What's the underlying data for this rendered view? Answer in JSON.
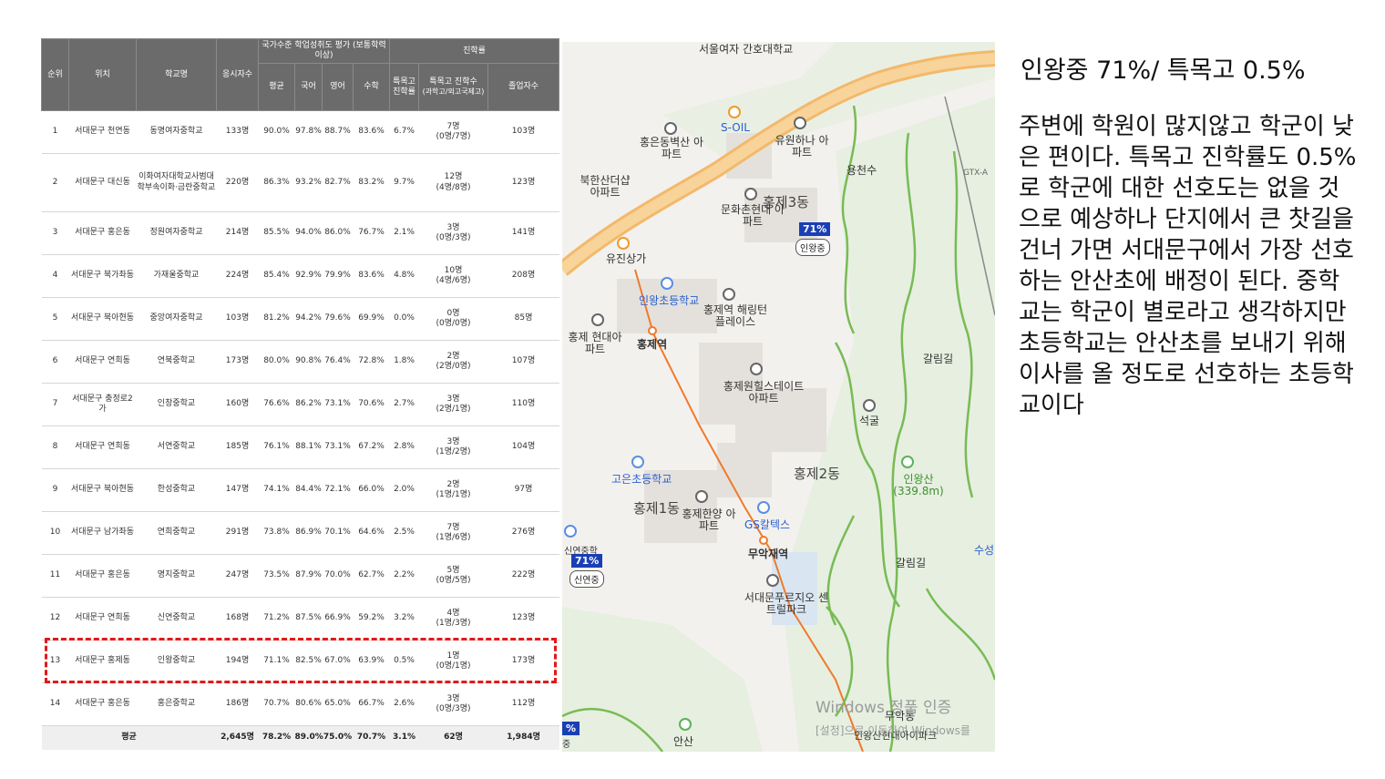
{
  "table": {
    "headers": {
      "rank": "순위",
      "location": "위치",
      "school": "학교명",
      "test_takers": "응시자수",
      "national_group": "국가수준 학업성취도 평가 (보통학력이상)",
      "avg": "평균",
      "korean": "국어",
      "english": "영어",
      "math": "수학",
      "advancement_group": "진학률",
      "special_rate": "특목고 진학률",
      "special_count": "특목고 진학수",
      "special_count_sub": "(과학고/외고국제고)",
      "graduates": "졸업자수"
    },
    "rows": [
      {
        "rank": "1",
        "location": "서대문구 천연동",
        "school": "동명여자중학교",
        "takers": "133명",
        "avg": "90.0%",
        "kor": "97.8%",
        "eng": "88.7%",
        "math": "83.6%",
        "rate": "6.7%",
        "count": "7명",
        "count_sub": "(0명/7명)",
        "grads": "103명"
      },
      {
        "rank": "2",
        "location": "서대문구 대신동",
        "school": "이화여자대학교사범대학부속이화·금란중학교",
        "takers": "220명",
        "avg": "86.3%",
        "kor": "93.2%",
        "eng": "82.7%",
        "math": "83.2%",
        "rate": "9.7%",
        "count": "12명",
        "count_sub": "(4명/8명)",
        "grads": "123명"
      },
      {
        "rank": "3",
        "location": "서대문구 홍은동",
        "school": "정원여자중학교",
        "takers": "214명",
        "avg": "85.5%",
        "kor": "94.0%",
        "eng": "86.0%",
        "math": "76.7%",
        "rate": "2.1%",
        "count": "3명",
        "count_sub": "(0명/3명)",
        "grads": "141명"
      },
      {
        "rank": "4",
        "location": "서대문구 북가좌동",
        "school": "가재울중학교",
        "takers": "224명",
        "avg": "85.4%",
        "kor": "92.9%",
        "eng": "79.9%",
        "math": "83.6%",
        "rate": "4.8%",
        "count": "10명",
        "count_sub": "(4명/6명)",
        "grads": "208명"
      },
      {
        "rank": "5",
        "location": "서대문구 북아현동",
        "school": "중앙여자중학교",
        "takers": "103명",
        "avg": "81.2%",
        "kor": "94.2%",
        "eng": "79.6%",
        "math": "69.9%",
        "rate": "0.0%",
        "count": "0명",
        "count_sub": "(0명/0명)",
        "grads": "85명"
      },
      {
        "rank": "6",
        "location": "서대문구 연희동",
        "school": "연북중학교",
        "takers": "173명",
        "avg": "80.0%",
        "kor": "90.8%",
        "eng": "76.4%",
        "math": "72.8%",
        "rate": "1.8%",
        "count": "2명",
        "count_sub": "(2명/0명)",
        "grads": "107명"
      },
      {
        "rank": "7",
        "location": "서대문구 충정로2가",
        "school": "인창중학교",
        "takers": "160명",
        "avg": "76.6%",
        "kor": "86.2%",
        "eng": "73.1%",
        "math": "70.6%",
        "rate": "2.7%",
        "count": "3명",
        "count_sub": "(2명/1명)",
        "grads": "110명"
      },
      {
        "rank": "8",
        "location": "서대문구 연희동",
        "school": "서연중학교",
        "takers": "185명",
        "avg": "76.1%",
        "kor": "88.1%",
        "eng": "73.1%",
        "math": "67.2%",
        "rate": "2.8%",
        "count": "3명",
        "count_sub": "(1명/2명)",
        "grads": "104명"
      },
      {
        "rank": "9",
        "location": "서대문구 북아현동",
        "school": "한성중학교",
        "takers": "147명",
        "avg": "74.1%",
        "kor": "84.4%",
        "eng": "72.1%",
        "math": "66.0%",
        "rate": "2.0%",
        "count": "2명",
        "count_sub": "(1명/1명)",
        "grads": "97명"
      },
      {
        "rank": "10",
        "location": "서대문구 남가좌동",
        "school": "연희중학교",
        "takers": "291명",
        "avg": "73.8%",
        "kor": "86.9%",
        "eng": "70.1%",
        "math": "64.6%",
        "rate": "2.5%",
        "count": "7명",
        "count_sub": "(1명/6명)",
        "grads": "276명"
      },
      {
        "rank": "11",
        "location": "서대문구 홍은동",
        "school": "명지중학교",
        "takers": "247명",
        "avg": "73.5%",
        "kor": "87.9%",
        "eng": "70.0%",
        "math": "62.7%",
        "rate": "2.2%",
        "count": "5명",
        "count_sub": "(0명/5명)",
        "grads": "222명"
      },
      {
        "rank": "12",
        "location": "서대문구 연희동",
        "school": "신연중학교",
        "takers": "168명",
        "avg": "71.2%",
        "kor": "87.5%",
        "eng": "66.9%",
        "math": "59.2%",
        "rate": "3.2%",
        "count": "4명",
        "count_sub": "(1명/3명)",
        "grads": "123명"
      },
      {
        "rank": "13",
        "location": "서대문구 홍제동",
        "school": "인왕중학교",
        "takers": "194명",
        "avg": "71.1%",
        "kor": "82.5%",
        "eng": "67.0%",
        "math": "63.9%",
        "rate": "0.5%",
        "count": "1명",
        "count_sub": "(0명/1명)",
        "grads": "173명"
      },
      {
        "rank": "14",
        "location": "서대문구 홍은동",
        "school": "홍은중학교",
        "takers": "186명",
        "avg": "70.7%",
        "kor": "80.6%",
        "eng": "65.0%",
        "math": "66.7%",
        "rate": "2.6%",
        "count": "3명",
        "count_sub": "(0명/3명)",
        "grads": "112명"
      }
    ],
    "average": {
      "label": "평균",
      "takers": "2,645명",
      "avg": "78.2%",
      "kor": "89.0%",
      "eng": "75.0%",
      "math": "70.7%",
      "rate": "3.1%",
      "count": "62명",
      "grads": "1,984명"
    }
  },
  "map": {
    "labels": {
      "seoul_women_nursing": "서울여자 간호대학교",
      "s_oil": "S-OIL",
      "hongeundong_apt": "홍은동벽산 아파트",
      "yuwon_hana_apt": "유원하나 아파트",
      "bukhansan_apt": "북한산더샵 아파트",
      "hongje3dong": "홍제3동",
      "munhwa_apt": "문화촌현대 아파트",
      "yongcheonsu": "용천수",
      "yujin_sangga": "유진상가",
      "inwang_elementary": "인왕초등학교",
      "hongje_station_place": "홍제역 해링턴플레이스",
      "hongje_hyundai_apt": "홍제 현대아파트",
      "hongje_station": "홍제역",
      "hongje_wonhills": "홍제원힐스테이트 아파트",
      "galrimgil": "갈림길",
      "seokgul": "석굴",
      "goeun_elementary": "고은초등학교",
      "hongje1dong": "홍제1동",
      "hongje2dong": "홍제2동",
      "hongje_hanyang_apt": "홍제한양 아파트",
      "gs_caltex": "GS칼텍스",
      "inwangsan": "인왕산 (339.8m)",
      "muakjae": "무악재역",
      "seodaemun_prugio": "서대문푸르지오 센트럴파크",
      "galrimgil2": "갈림길",
      "gtx": "GTX-A",
      "windows_watermark": "Windows 정품 인증",
      "windows_watermark_sub": "[설정]으로 이동하여 Windows를",
      "ansan": "안산",
      "muakdong": "무악동",
      "inwangsan_hyundai": "인왕산현대아이파크",
      "suseong": "수성",
      "sinyeon_partial": "신연중학",
      "jung_partial": "중"
    },
    "flags": {
      "inwang_pct": "71%",
      "inwang_name": "인왕중",
      "sinyeon_pct": "71%",
      "sinyeon_name": "신연중",
      "bottom_pct": "%"
    }
  },
  "commentary": {
    "headline": "인왕중 71%/ 특목고 0.5%",
    "body": "주변에 학원이 많지않고 학군이 낮은 편이다. 특목고 진학률도 0.5%로 학군에 대한 선호도는 없을 것으로 예상하나 단지에서 큰 찻길을 건너 가면 서대문구에서 가장 선호하는 안산초에 배정이 된다. 중학교는 학군이 별로라고 생각하지만 초등학교는 안산초를 보내기 위해 이사를 올 정도로 선호하는 초등학교이다"
  },
  "colors": {
    "header_bg": "#6b6b6b",
    "highlight": "#e01a1a",
    "road_orange": "#f6c07a",
    "trail_green": "#6fb84a",
    "flag_blue": "#1a3fb5"
  }
}
